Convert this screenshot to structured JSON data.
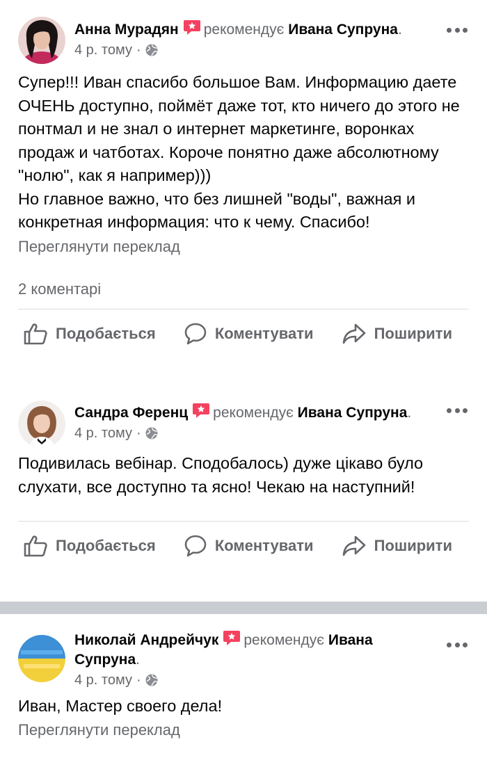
{
  "colors": {
    "primary_text": "#050505",
    "secondary_text": "#65676b",
    "recommend_badge": "#f3425f",
    "divider": "#dadde1",
    "separator": "#c9ccd1"
  },
  "posts": [
    {
      "author": "Анна Мурадян",
      "verb": "рекомендує",
      "target": "Ивана Супруна",
      "target_suffix": ".",
      "time": "4 р. тому",
      "dot": "·",
      "body": "Супер!!! Иван спасибо большое Вам. Информацию даете ОЧЕНЬ доступно, поймёт даже тот, кто ничего до этого не понтмал и не знал о интернет маркетинге, воронках продаж и чатботах. Короче понятно даже абсолютному \"нолю\", как я например)))\nНо главное важно, что без лишней \"воды\", важная и конкретная информация: что к чему. Спасибо!",
      "translate": "Переглянути переклад",
      "comments": "2 коментарі"
    },
    {
      "author": "Сандра Ференц",
      "verb": "рекомендує",
      "target": "Ивана Супруна",
      "target_suffix": ".",
      "time": "4 р. тому",
      "dot": "·",
      "body": "Подивилась вебінар. Сподобалось) дуже цікаво було слухати, все доступно та ясно! Чекаю на наступний!"
    },
    {
      "author": "Николай Андрейчук",
      "verb": "рекомендує",
      "target": "Ивана Супруна",
      "target_suffix": ".",
      "time": "4 р. тому",
      "dot": "·",
      "body": "Иван, Мастер своего дела!",
      "translate": "Переглянути переклад"
    }
  ],
  "actions": {
    "like": "Подобається",
    "comment": "Коментувати",
    "share": "Поширити"
  },
  "icons": {
    "more": "more-horizontal-icon",
    "globe": "globe-icon",
    "recommend": "recommend-star-icon",
    "like": "thumbs-up-icon",
    "comment": "comment-bubble-icon",
    "share": "share-arrow-icon"
  }
}
